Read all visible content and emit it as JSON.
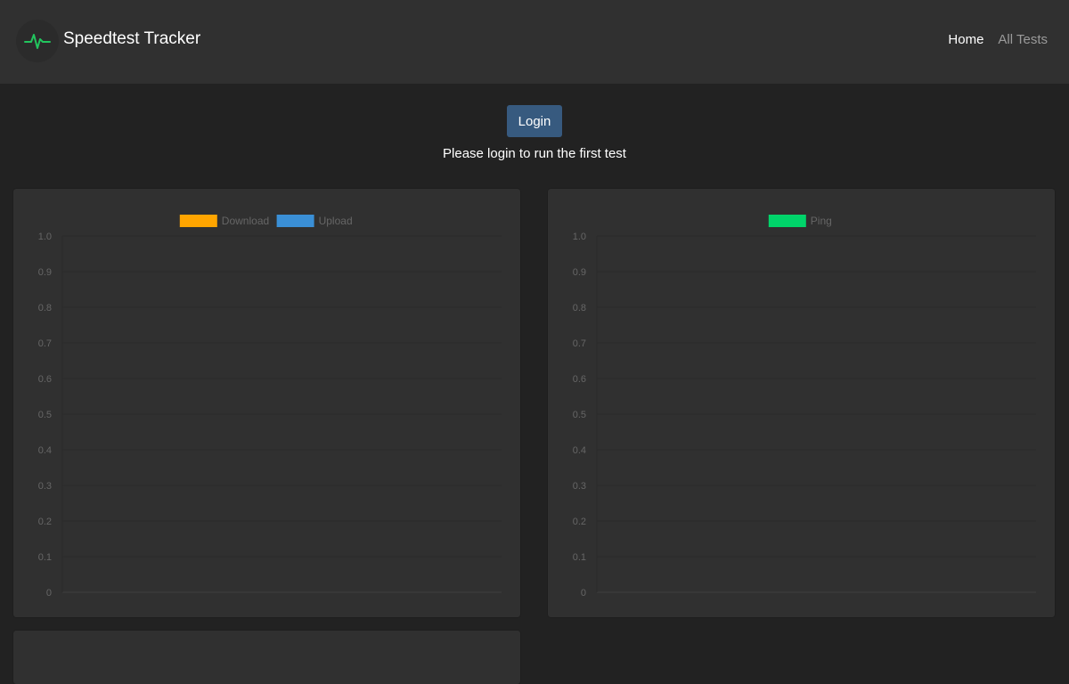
{
  "header": {
    "title": "Speedtest Tracker",
    "nav": [
      {
        "label": "Home",
        "active": true
      },
      {
        "label": "All Tests",
        "active": false
      }
    ],
    "logo_icon": "heartbeat-pulse-icon",
    "accent_color": "#22c55e"
  },
  "auth": {
    "login_label": "Login",
    "message": "Please login to run the first test"
  },
  "chart_data": [
    {
      "type": "line",
      "series": [
        {
          "name": "Download",
          "color": "#ffa500",
          "values": []
        },
        {
          "name": "Upload",
          "color": "#3a8fd6",
          "values": []
        }
      ],
      "y_ticks": [
        "1.0",
        "0.9",
        "0.8",
        "0.7",
        "0.6",
        "0.5",
        "0.4",
        "0.3",
        "0.2",
        "0.1",
        "0"
      ],
      "ylim": [
        0,
        1
      ],
      "grid": true,
      "legend": "top-center"
    },
    {
      "type": "line",
      "series": [
        {
          "name": "Ping",
          "color": "#00d46a",
          "values": []
        }
      ],
      "y_ticks": [
        "1.0",
        "0.9",
        "0.8",
        "0.7",
        "0.6",
        "0.5",
        "0.4",
        "0.3",
        "0.2",
        "0.1",
        "0"
      ],
      "ylim": [
        0,
        1
      ],
      "grid": true,
      "legend": "top-center"
    }
  ]
}
